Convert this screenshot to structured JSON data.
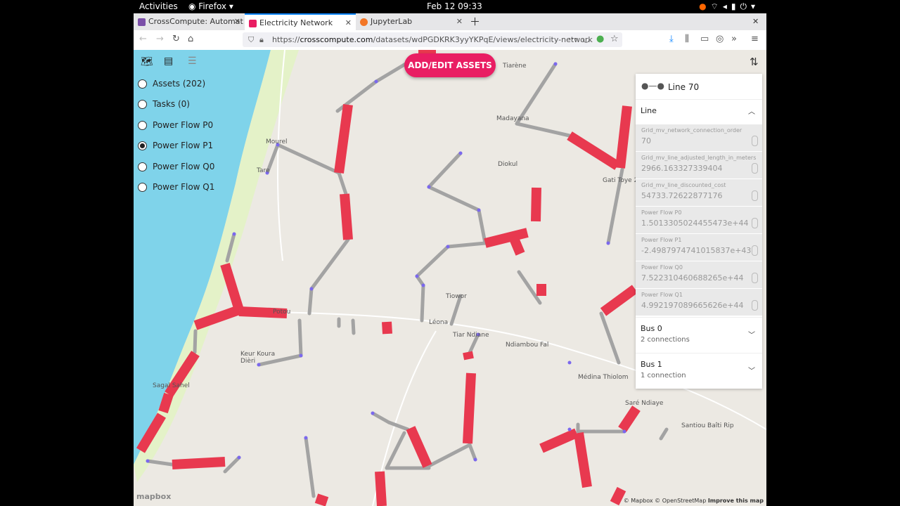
{
  "system": {
    "activities": "Activities",
    "app": "Firefox",
    "clock": "Feb 12  09:33"
  },
  "tabs": [
    {
      "label": "CrossCompute: Automat",
      "favicon_color": "#7b4fa8"
    },
    {
      "label": "Electricity Network",
      "favicon_color": "#e91e63"
    },
    {
      "label": "JupyterLab",
      "favicon_color": "#f37626"
    }
  ],
  "address": {
    "host": "crosscompute.com",
    "prefix": "https://",
    "path": "/datasets/wdPGDKRK3yyYKPqE/views/electricity-network"
  },
  "layers": {
    "items": [
      {
        "label": "Assets (202)",
        "selected": false
      },
      {
        "label": "Tasks (0)",
        "selected": false
      },
      {
        "label": "Power Flow P0",
        "selected": false
      },
      {
        "label": "Power Flow P1",
        "selected": true
      },
      {
        "label": "Power Flow Q0",
        "selected": false
      },
      {
        "label": "Power Flow Q1",
        "selected": false
      }
    ]
  },
  "toolbar": {
    "add_edit_label": "ADD/EDIT ASSETS"
  },
  "places": [
    {
      "name": "Tiarène"
    },
    {
      "name": "Madayana"
    },
    {
      "name": "Diokul"
    },
    {
      "name": "Gati Toye 2"
    },
    {
      "name": "Mourel"
    },
    {
      "name": "Tare"
    },
    {
      "name": "Potou"
    },
    {
      "name": "Tiowor"
    },
    {
      "name": "Léona"
    },
    {
      "name": "Tiar Ndiane"
    },
    {
      "name": "Ndiambou Fal"
    },
    {
      "name": "Keur Koura Dièri"
    },
    {
      "name": "Sagal Sahel"
    },
    {
      "name": "Médina Thiolom"
    },
    {
      "name": "Saré Ndiaye"
    },
    {
      "name": "Santiou Baîti Rip"
    }
  ],
  "panel": {
    "title": "Line 70",
    "section_line": "Line",
    "fields": [
      {
        "key": "Grid_mv_network_connection_order",
        "value": "70"
      },
      {
        "key": "Grid_mv_line_adjusted_length_in_meters",
        "value": "2966.163327339404"
      },
      {
        "key": "Grid_mv_line_discounted_cost",
        "value": "54733.72622877176"
      },
      {
        "key": "Power Flow P0",
        "value": "1.5013305024455473e+44"
      },
      {
        "key": "Power Flow P1",
        "value": "-2.4987974741015837e+43"
      },
      {
        "key": "Power Flow Q0",
        "value": "7.522310460688265e+44"
      },
      {
        "key": "Power Flow Q1",
        "value": "4.992197089665626e+44"
      }
    ],
    "bus0": {
      "title": "Bus 0",
      "sub": "2 connections"
    },
    "bus1": {
      "title": "Bus 1",
      "sub": "1 connection"
    }
  },
  "attribution": {
    "logo": "mapbox",
    "text": "© Mapbox © OpenStreetMap",
    "improve": "Improve this map"
  },
  "colors": {
    "accent": "#e91e63",
    "line_red": "#e8394f",
    "line_gray": "#a3a3a3",
    "sea": "#7fd3ea"
  }
}
